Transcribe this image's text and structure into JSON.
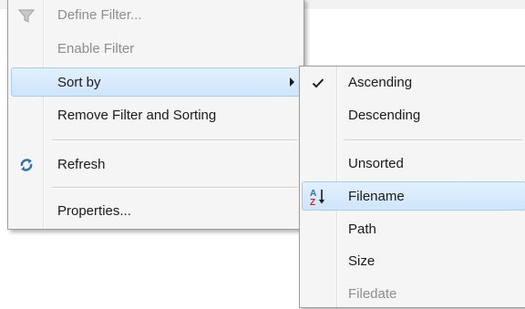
{
  "main_menu": {
    "items": [
      {
        "label": "Define Filter...",
        "icon": "funnel-icon",
        "disabled": true
      },
      {
        "label": "Enable Filter",
        "disabled": true
      },
      {
        "label": "Sort by",
        "highlighted": true,
        "has_submenu": true
      },
      {
        "label": "Remove Filter and Sorting"
      },
      {
        "label": "Refresh",
        "icon": "refresh-icon"
      },
      {
        "label": "Properties..."
      }
    ]
  },
  "sort_submenu": {
    "items": [
      {
        "label": "Ascending",
        "checked": true,
        "icon": "checkmark-icon"
      },
      {
        "label": "Descending"
      },
      {
        "label": "Unsorted"
      },
      {
        "label": "Filename",
        "highlighted": true,
        "icon": "sort-az-icon"
      },
      {
        "label": "Path"
      },
      {
        "label": "Size"
      },
      {
        "label": "Filedate",
        "disabled": true
      }
    ]
  },
  "colors": {
    "highlight": "#d7e9fc",
    "highlight_border": "#a7cdf0",
    "disabled_text": "#8d8d8d",
    "menu_background": "#f5f5f5"
  }
}
